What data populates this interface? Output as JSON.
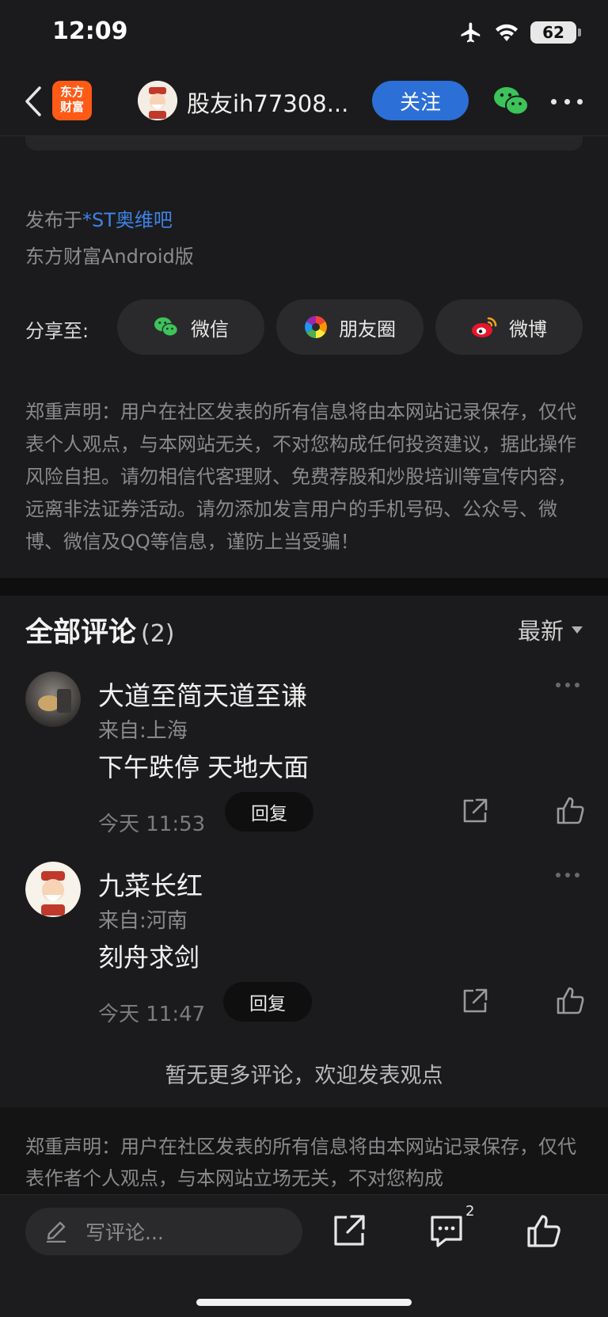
{
  "status_bar": {
    "time": "12:09",
    "battery": "62"
  },
  "nav": {
    "logo_line1": "东方",
    "logo_line2": "财富",
    "author_name": "股友ih77308...",
    "follow_label": "关注"
  },
  "post_meta": {
    "forum_prefix": "发布于",
    "forum_name": "*ST奥维吧",
    "client": "东方财富Android版"
  },
  "share": {
    "label": "分享至:",
    "targets": [
      {
        "label": "微信",
        "icon": "wechat-icon"
      },
      {
        "label": "朋友圈",
        "icon": "moments-icon"
      },
      {
        "label": "微博",
        "icon": "weibo-icon"
      }
    ]
  },
  "disclaimer_top": "郑重声明：用户在社区发表的所有信息将由本网站记录保存，仅代表个人观点，与本网站无关，不对您构成任何投资建议，据此操作风险自担。请勿相信代客理财、免费荐股和炒股培训等宣传内容，远离非法证券活动。请勿添加发言用户的手机号码、公众号、微博、微信及QQ等信息，谨防上当受骗！",
  "comments": {
    "title": "全部评论",
    "count": "(2)",
    "sort_label": "最新",
    "items": [
      {
        "name": "大道至简天道至谦",
        "location": "来自:上海",
        "text": "下午跌停 天地大面",
        "time": "今天 11:53",
        "reply_label": "回复"
      },
      {
        "name": "九菜长红",
        "location": "来自:河南",
        "text": "刻舟求剑",
        "time": "今天 11:47",
        "reply_label": "回复"
      }
    ],
    "no_more": "暂无更多评论，欢迎发表观点"
  },
  "disclaimer_bottom": "郑重声明：用户在社区发表的所有信息将由本网站记录保存，仅代表作者个人观点，与本网站立场无关，不对您构成",
  "bottom_bar": {
    "input_placeholder": "写评论...",
    "comment_badge": "2"
  },
  "colors": {
    "background": "#1b1b1d",
    "accent_blue": "#2c6fd6",
    "link_blue": "#3d83e6",
    "brand_orange": "#ff5a16"
  }
}
